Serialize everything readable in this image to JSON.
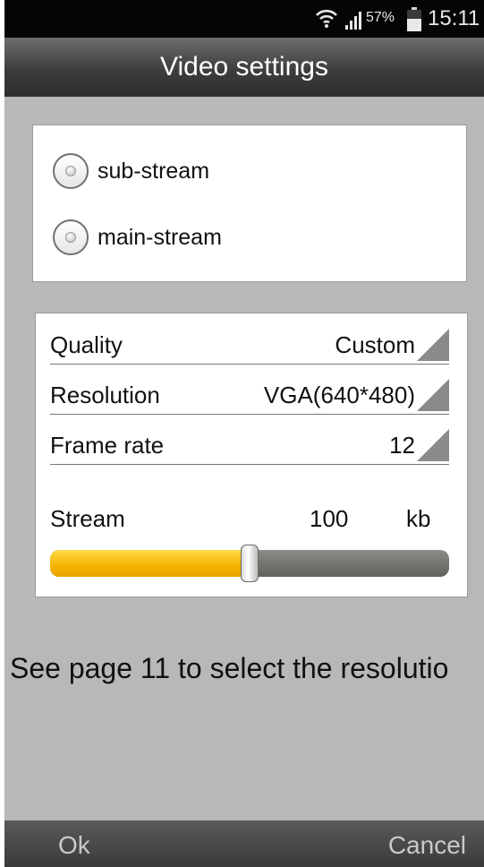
{
  "status_bar": {
    "battery_percent": "57%",
    "battery_level": 0.57,
    "time": "15:11",
    "icons": [
      "wifi-icon",
      "signal-icon",
      "battery-icon"
    ]
  },
  "header": {
    "title": "Video settings"
  },
  "stream_select": {
    "options": [
      {
        "label": "sub-stream",
        "selected": false
      },
      {
        "label": "main-stream",
        "selected": false
      }
    ]
  },
  "video_params": {
    "quality": {
      "label": "Quality",
      "value": "Custom"
    },
    "resolution": {
      "label": "Resolution",
      "value": "VGA(640*480)"
    },
    "frame_rate": {
      "label": "Frame rate",
      "value": "12"
    },
    "stream": {
      "label": "Stream",
      "value": "100",
      "unit": "kb",
      "slider_fraction": 0.5
    }
  },
  "hint": "See page 11 to select the resolutio",
  "footer": {
    "ok_label": "Ok",
    "cancel_label": "Cancel"
  },
  "colors": {
    "background": "#b8b8b8",
    "slider_fill": "#f4b400",
    "slider_track": "#6e706c",
    "title_bar": "#3d3d3d"
  }
}
